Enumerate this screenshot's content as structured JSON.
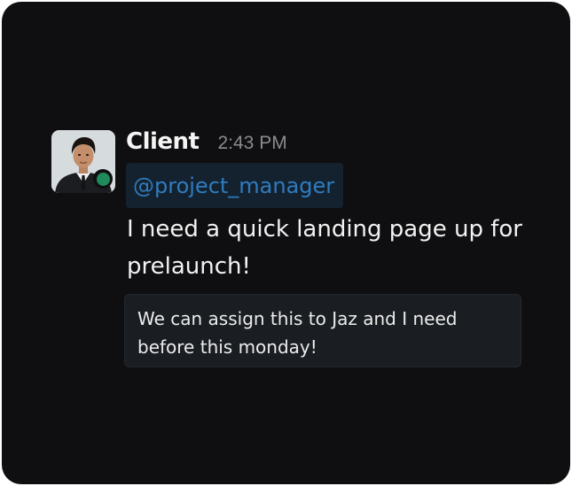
{
  "message": {
    "avatar_icon": "person-avatar-icon",
    "presence_status": "online",
    "presence_color": "#1f8a5b",
    "sender_name": "Client",
    "timestamp": "2:43 PM",
    "mention": "@project_manager",
    "mention_color": "#2f7bc0",
    "body": "I need a quick landing page up for prelaunch!",
    "quote": "We can assign this to Jaz and I need before this monday!"
  }
}
